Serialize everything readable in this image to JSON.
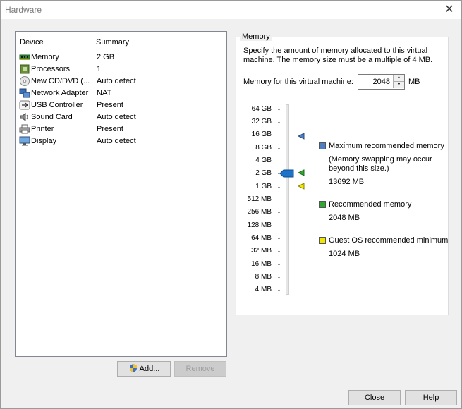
{
  "window": {
    "title": "Hardware",
    "close_glyph": "✕"
  },
  "device_list": {
    "headers": {
      "device": "Device",
      "summary": "Summary"
    },
    "rows": [
      {
        "name": "Memory",
        "summary": "2 GB",
        "icon": "memory-icon"
      },
      {
        "name": "Processors",
        "summary": "1",
        "icon": "processor-icon"
      },
      {
        "name": "New CD/DVD (...",
        "summary": "Auto detect",
        "icon": "cd-dvd-icon"
      },
      {
        "name": "Network Adapter",
        "summary": "NAT",
        "icon": "network-adapter-icon"
      },
      {
        "name": "USB Controller",
        "summary": "Present",
        "icon": "usb-icon"
      },
      {
        "name": "Sound Card",
        "summary": "Auto detect",
        "icon": "sound-card-icon"
      },
      {
        "name": "Printer",
        "summary": "Present",
        "icon": "printer-icon"
      },
      {
        "name": "Display",
        "summary": "Auto detect",
        "icon": "display-icon"
      }
    ]
  },
  "buttons": {
    "add": "Add...",
    "remove": "Remove",
    "close": "Close",
    "help": "Help"
  },
  "memory": {
    "group_title": "Memory",
    "description": "Specify the amount of memory allocated to this virtual machine. The memory size must be a multiple of 4 MB.",
    "field_label": "Memory for this virtual machine:",
    "value": "2048",
    "unit": "MB",
    "scale": [
      "64 GB",
      "32 GB",
      "16 GB",
      "8 GB",
      "4 GB",
      "2 GB",
      "1 GB",
      "512 MB",
      "256 MB",
      "128 MB",
      "64 MB",
      "32 MB",
      "16 MB",
      "8 MB",
      "4 MB"
    ],
    "legend": {
      "max_title": "Maximum recommended memory",
      "max_note": "(Memory swapping may occur beyond this size.)",
      "max_value": "13692 MB",
      "rec_title": "Recommended memory",
      "rec_value": "2048 MB",
      "min_title": "Guest OS recommended minimum",
      "min_value": "1024 MB"
    },
    "colors": {
      "max": "#4a7fc6",
      "recommended": "#2ea82e",
      "minimum": "#f2e600",
      "thumb": "#1e73c8"
    }
  }
}
